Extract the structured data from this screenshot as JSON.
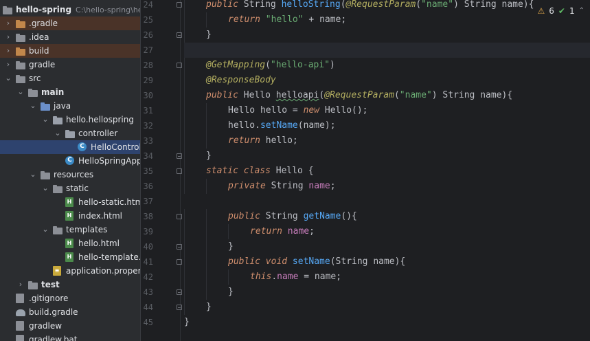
{
  "project": {
    "name": "hello-spring",
    "path": "C:\\hello-spring\\hello-spring"
  },
  "tree": [
    {
      "label": ".gradle",
      "depth": 0,
      "arrow": "›",
      "icon": "folder-orange",
      "style": "hl-orange"
    },
    {
      "label": ".idea",
      "depth": 0,
      "arrow": "›",
      "icon": "folder"
    },
    {
      "label": "build",
      "depth": 0,
      "arrow": "›",
      "icon": "folder-orange",
      "style": "hl-orange"
    },
    {
      "label": "gradle",
      "depth": 0,
      "arrow": "›",
      "icon": "folder"
    },
    {
      "label": "src",
      "depth": 0,
      "arrow": "⌄",
      "icon": "folder"
    },
    {
      "label": "main",
      "depth": 1,
      "arrow": "⌄",
      "icon": "folder",
      "bold": true
    },
    {
      "label": "java",
      "depth": 2,
      "arrow": "⌄",
      "icon": "folder-blue"
    },
    {
      "label": "hello.hellospring",
      "depth": 3,
      "arrow": "⌄",
      "icon": "package"
    },
    {
      "label": "controller",
      "depth": 4,
      "arrow": "⌄",
      "icon": "package"
    },
    {
      "label": "HelloController",
      "depth": 5,
      "arrow": "",
      "icon": "class",
      "style": "sel"
    },
    {
      "label": "HelloSpringApplication",
      "depth": 4,
      "arrow": "",
      "icon": "class"
    },
    {
      "label": "resources",
      "depth": 2,
      "arrow": "⌄",
      "icon": "folder"
    },
    {
      "label": "static",
      "depth": 3,
      "arrow": "⌄",
      "icon": "folder"
    },
    {
      "label": "hello-static.html",
      "depth": 4,
      "arrow": "",
      "icon": "html"
    },
    {
      "label": "index.html",
      "depth": 4,
      "arrow": "",
      "icon": "html"
    },
    {
      "label": "templates",
      "depth": 3,
      "arrow": "⌄",
      "icon": "folder"
    },
    {
      "label": "hello.html",
      "depth": 4,
      "arrow": "",
      "icon": "html"
    },
    {
      "label": "hello-template.html",
      "depth": 4,
      "arrow": "",
      "icon": "html"
    },
    {
      "label": "application.properties",
      "depth": 3,
      "arrow": "",
      "icon": "props"
    },
    {
      "label": "test",
      "depth": 1,
      "arrow": "›",
      "icon": "folder",
      "bold": true
    },
    {
      "label": ".gitignore",
      "depth": 0,
      "arrow": "",
      "icon": "file"
    },
    {
      "label": "build.gradle",
      "depth": 0,
      "arrow": "",
      "icon": "gradle"
    },
    {
      "label": "gradlew",
      "depth": 0,
      "arrow": "",
      "icon": "file"
    },
    {
      "label": "gradlew.bat",
      "depth": 0,
      "arrow": "",
      "icon": "file"
    }
  ],
  "inspection": {
    "warnings": "6",
    "checks": "1"
  },
  "code": [
    {
      "n": "24",
      "indent": 1,
      "fold": "start",
      "tokens": [
        [
          "kw",
          "public "
        ],
        [
          "plain",
          "String "
        ],
        [
          "fn",
          "helloString"
        ],
        [
          "plain",
          "("
        ],
        [
          "ann",
          "@RequestParam"
        ],
        [
          "plain",
          "("
        ],
        [
          "str",
          "\"name\""
        ],
        [
          "plain",
          ") String name){"
        ]
      ]
    },
    {
      "n": "25",
      "indent": 2,
      "tokens": [
        [
          "kw",
          "return "
        ],
        [
          "str",
          "\"hello\""
        ],
        [
          "plain",
          " + name;"
        ]
      ]
    },
    {
      "n": "26",
      "indent": 1,
      "fold": "end",
      "tokens": [
        [
          "plain",
          "}"
        ]
      ]
    },
    {
      "n": "27",
      "indent": 0,
      "current": true,
      "tokens": []
    },
    {
      "n": "28",
      "indent": 1,
      "fold": "start",
      "tokens": [
        [
          "ann",
          "@GetMapping"
        ],
        [
          "plain",
          "("
        ],
        [
          "str",
          "\"hello-api\""
        ],
        [
          "plain",
          ")"
        ]
      ]
    },
    {
      "n": "29",
      "indent": 1,
      "tokens": [
        [
          "ann",
          "@ResponseBody"
        ]
      ]
    },
    {
      "n": "30",
      "indent": 1,
      "tokens": [
        [
          "kw",
          "public "
        ],
        [
          "plain",
          "Hello "
        ],
        [
          "unused",
          "helloapi"
        ],
        [
          "plain",
          "("
        ],
        [
          "ann",
          "@RequestParam"
        ],
        [
          "plain",
          "("
        ],
        [
          "str",
          "\"name\""
        ],
        [
          "plain",
          ") String name){"
        ]
      ]
    },
    {
      "n": "31",
      "indent": 2,
      "tokens": [
        [
          "plain",
          "Hello hello = "
        ],
        [
          "kw",
          "new "
        ],
        [
          "plain",
          "Hello();"
        ]
      ]
    },
    {
      "n": "32",
      "indent": 2,
      "tokens": [
        [
          "plain",
          "hello."
        ],
        [
          "fn",
          "setName"
        ],
        [
          "plain",
          "(name);"
        ]
      ]
    },
    {
      "n": "33",
      "indent": 2,
      "tokens": [
        [
          "kw",
          "return "
        ],
        [
          "plain",
          "hello;"
        ]
      ]
    },
    {
      "n": "34",
      "indent": 1,
      "fold": "end",
      "tokens": [
        [
          "plain",
          "}"
        ]
      ]
    },
    {
      "n": "35",
      "indent": 1,
      "fold": "start",
      "tokens": [
        [
          "kw",
          "static class "
        ],
        [
          "plain",
          "Hello {"
        ]
      ]
    },
    {
      "n": "36",
      "indent": 2,
      "tokens": [
        [
          "kw",
          "private "
        ],
        [
          "plain",
          "String "
        ],
        [
          "field",
          "name"
        ],
        [
          "plain",
          ";"
        ]
      ]
    },
    {
      "n": "37",
      "indent": 0,
      "tokens": []
    },
    {
      "n": "38",
      "indent": 2,
      "fold": "start",
      "tokens": [
        [
          "kw",
          "public "
        ],
        [
          "plain",
          "String "
        ],
        [
          "fn",
          "getName"
        ],
        [
          "plain",
          "(){"
        ]
      ]
    },
    {
      "n": "39",
      "indent": 3,
      "tokens": [
        [
          "kw",
          "return "
        ],
        [
          "field",
          "name"
        ],
        [
          "plain",
          ";"
        ]
      ]
    },
    {
      "n": "40",
      "indent": 2,
      "fold": "end",
      "tokens": [
        [
          "plain",
          "}"
        ]
      ]
    },
    {
      "n": "41",
      "indent": 2,
      "fold": "start",
      "tokens": [
        [
          "kw",
          "public void "
        ],
        [
          "fn",
          "setName"
        ],
        [
          "plain",
          "(String name){"
        ]
      ]
    },
    {
      "n": "42",
      "indent": 3,
      "tokens": [
        [
          "kw",
          "this"
        ],
        [
          "plain",
          "."
        ],
        [
          "field",
          "name"
        ],
        [
          "plain",
          " = name;"
        ]
      ]
    },
    {
      "n": "43",
      "indent": 2,
      "fold": "end",
      "tokens": [
        [
          "plain",
          "}"
        ]
      ]
    },
    {
      "n": "44",
      "indent": 1,
      "fold": "end",
      "tokens": [
        [
          "plain",
          "}"
        ]
      ]
    },
    {
      "n": "45",
      "indent": 0,
      "tokens": [
        [
          "plain",
          "}"
        ]
      ]
    }
  ]
}
